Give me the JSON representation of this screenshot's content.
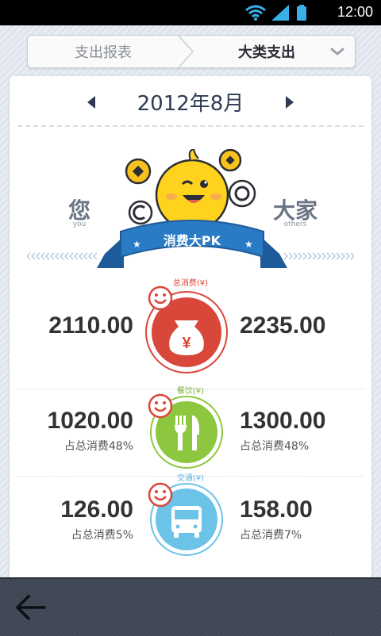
{
  "status_bar": {
    "time": "12:00"
  },
  "breadcrumb": {
    "left_label": "支出报表",
    "right_label": "大类支出"
  },
  "month": {
    "label": "2012年8月"
  },
  "pk": {
    "you_label": "您",
    "you_sub": "you",
    "others_label": "大家",
    "others_sub": "others",
    "banner": "消费大PK"
  },
  "categories": [
    {
      "label": "总消费(¥)",
      "you_value": "2110.00",
      "others_value": "2235.00",
      "color": "#d9463a"
    },
    {
      "label": "餐饮(¥)",
      "you_value": "1020.00",
      "you_pct": "占总消费48%",
      "others_value": "1300.00",
      "others_pct": "占总消费48%",
      "color": "#8dc63f"
    },
    {
      "label": "交通(¥)",
      "you_value": "126.00",
      "you_pct": "占总消费5%",
      "others_value": "158.00",
      "others_pct": "占总消费7%",
      "color": "#6cc3e8"
    }
  ],
  "icons": {
    "prev": "left-triangle",
    "next": "right-triangle",
    "chevron": "chevron-down",
    "total": "money-bag-icon",
    "food": "fork-knife-icon",
    "transport": "bus-icon",
    "back": "back-arrow-icon"
  }
}
